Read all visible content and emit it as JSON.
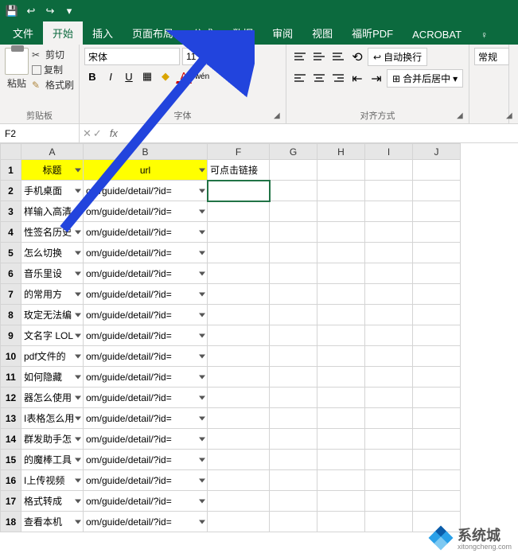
{
  "qat": {
    "save": "💾",
    "undo": "↩",
    "redo": "↪",
    "custom": "▾"
  },
  "tabs": {
    "file": "文件",
    "home": "开始",
    "insert": "插入",
    "layout": "页面布局",
    "formulas": "公式",
    "data": "数据",
    "review": "审阅",
    "view": "视图",
    "foxit": "福昕PDF",
    "acrobat": "ACROBAT",
    "tell": "♀"
  },
  "ribbon": {
    "clipboard": {
      "paste": "粘贴",
      "cut": "剪切",
      "copy": "复制",
      "painter": "格式刷",
      "label": "剪贴板"
    },
    "font": {
      "name": "宋体",
      "size": "11",
      "inc": "A",
      "dec": "A",
      "bold": "B",
      "italic": "I",
      "underline": "U",
      "label": "字体",
      "border": "▦",
      "fill": "◆",
      "color": "A",
      "phonetic": "wén"
    },
    "align": {
      "wrap": "自动换行",
      "merge": "合并后居中",
      "label": "对齐方式"
    },
    "number": {
      "general": "常规"
    }
  },
  "namebox": "F2",
  "columns": {
    "A": "A",
    "B": "B",
    "F": "F",
    "G": "G",
    "H": "H",
    "I": "I",
    "J": "J"
  },
  "headers": {
    "title": "标题",
    "url": "url",
    "link": "可点击链接"
  },
  "rows": [
    {
      "n": "1"
    },
    {
      "n": "2",
      "a": "手机桌面",
      "b": "om/guide/detail/?id="
    },
    {
      "n": "3",
      "a": "样输入高清",
      "b": "om/guide/detail/?id="
    },
    {
      "n": "4",
      "a": "性签名历史",
      "b": "om/guide/detail/?id="
    },
    {
      "n": "5",
      "a": "怎么切换",
      "b": "om/guide/detail/?id="
    },
    {
      "n": "6",
      "a": "音乐里设",
      "b": "om/guide/detail/?id="
    },
    {
      "n": "7",
      "a": "的常用方",
      "b": "om/guide/detail/?id="
    },
    {
      "n": "8",
      "a": "玫定无法编",
      "b": "om/guide/detail/?id="
    },
    {
      "n": "9",
      "a": "文名字 LOL",
      "b": "om/guide/detail/?id="
    },
    {
      "n": "10",
      "a": "pdf文件的",
      "b": "om/guide/detail/?id="
    },
    {
      "n": "11",
      "a": "如何隐藏",
      "b": "om/guide/detail/?id="
    },
    {
      "n": "12",
      "a": "器怎么使用",
      "b": "om/guide/detail/?id="
    },
    {
      "n": "13",
      "a": "I表格怎么用",
      "b": "om/guide/detail/?id="
    },
    {
      "n": "14",
      "a": "群发助手怎",
      "b": "om/guide/detail/?id="
    },
    {
      "n": "15",
      "a": "的魔棒工具",
      "b": "om/guide/detail/?id="
    },
    {
      "n": "16",
      "a": "I上传视频",
      "b": "om/guide/detail/?id="
    },
    {
      "n": "17",
      "a": "格式转成",
      "b": "om/guide/detail/?id="
    },
    {
      "n": "18",
      "a": "查看本机",
      "b": "om/guide/detail/?id="
    }
  ],
  "watermark": {
    "name": "系统城",
    "url": "xitongcheng.com"
  }
}
